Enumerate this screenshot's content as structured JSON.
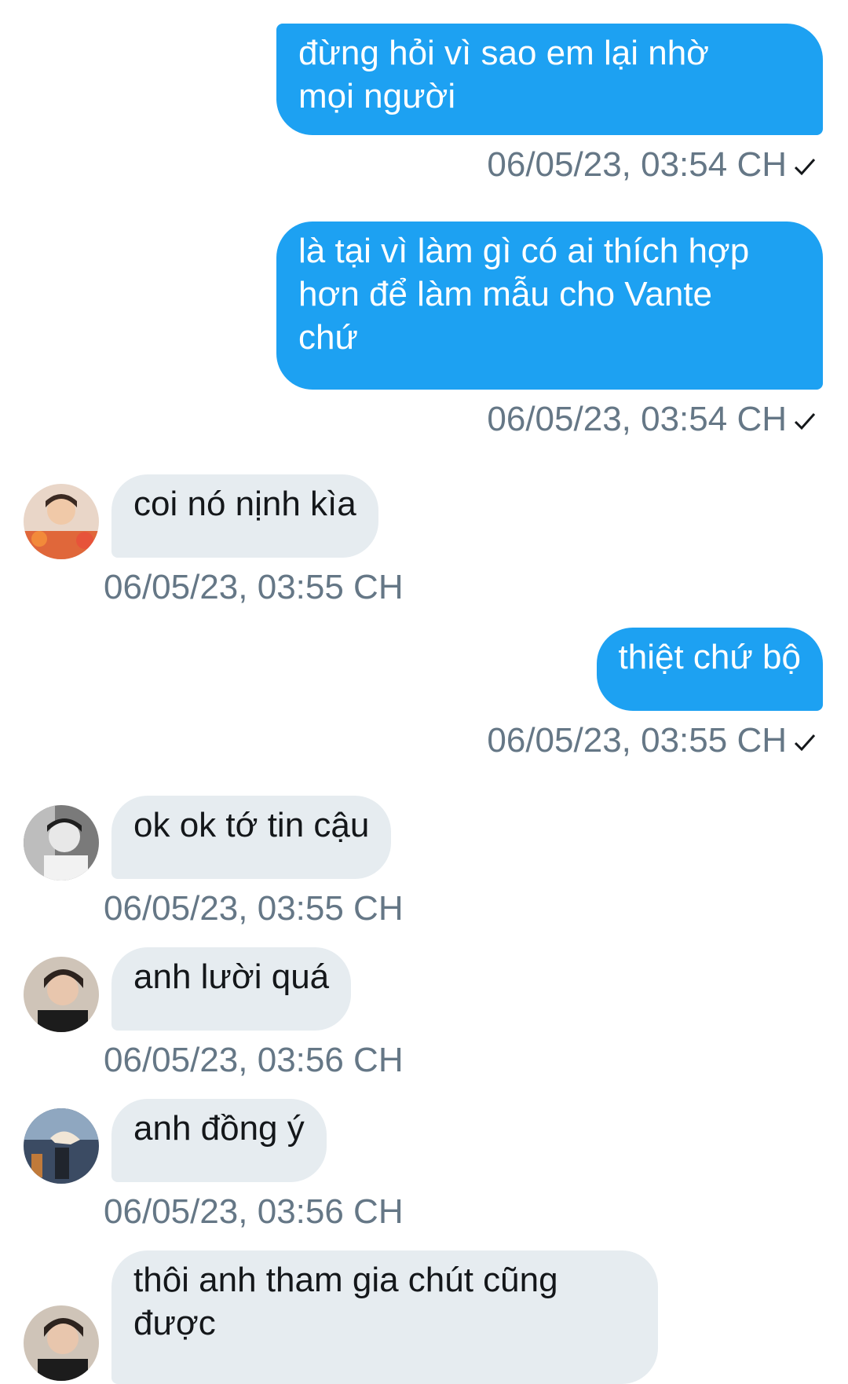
{
  "messages": [
    {
      "text": "đừng hỏi vì sao em lại nhờ\nmọi người",
      "time": "06/05/23, 03:54 CH"
    },
    {
      "text": "là tại vì làm gì có ai thích hợp\nhơn để làm mẫu cho Vante\nchứ",
      "time": "06/05/23, 03:54 CH"
    },
    {
      "text": "coi nó nịnh kìa",
      "time": "06/05/23, 03:55 CH"
    },
    {
      "text": "thiệt chứ bộ",
      "time": "06/05/23, 03:55 CH"
    },
    {
      "text": "ok ok tớ tin cậu",
      "time": "06/05/23, 03:55 CH"
    },
    {
      "text": "anh lười quá",
      "time": "06/05/23, 03:56 CH"
    },
    {
      "text": "anh đồng ý",
      "time": "06/05/23, 03:56 CH"
    },
    {
      "text": "thôi anh tham gia chút cũng\nđược"
    }
  ],
  "colors": {
    "outgoing_bubble": "#1da1f2",
    "incoming_bubble": "#e6ecf0",
    "timestamp": "#657786"
  },
  "icons": {
    "read_receipt": "check-icon",
    "avatar": "user-avatar"
  }
}
